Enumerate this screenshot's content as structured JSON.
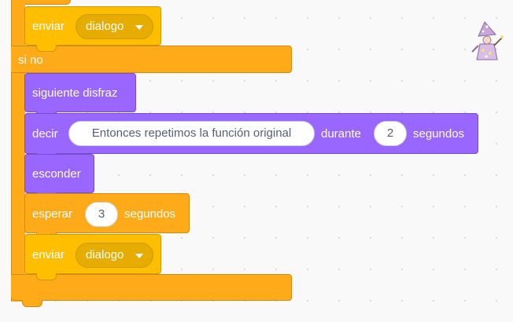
{
  "script": {
    "top_send": {
      "label": "enviar",
      "message": "dialogo"
    },
    "else_label": "si no",
    "next_costume": {
      "label": "siguiente disfraz"
    },
    "say_for": {
      "label": "decir",
      "text": "Entonces repetimos la función original",
      "middle": "durante",
      "seconds": "2",
      "unit": "segundos"
    },
    "hide": {
      "label": "esconder"
    },
    "wait": {
      "label": "esperar",
      "seconds": "3",
      "unit": "segundos"
    },
    "bottom_send": {
      "label": "enviar",
      "message": "dialogo"
    }
  },
  "colors": {
    "control": "#ffab19",
    "events": "#ffbf00",
    "looks": "#9966ff",
    "dropdown": "#e6ac00"
  },
  "icons": {
    "sprite": "wizard-sprite-icon",
    "dropdown": "chevron-down-icon"
  }
}
